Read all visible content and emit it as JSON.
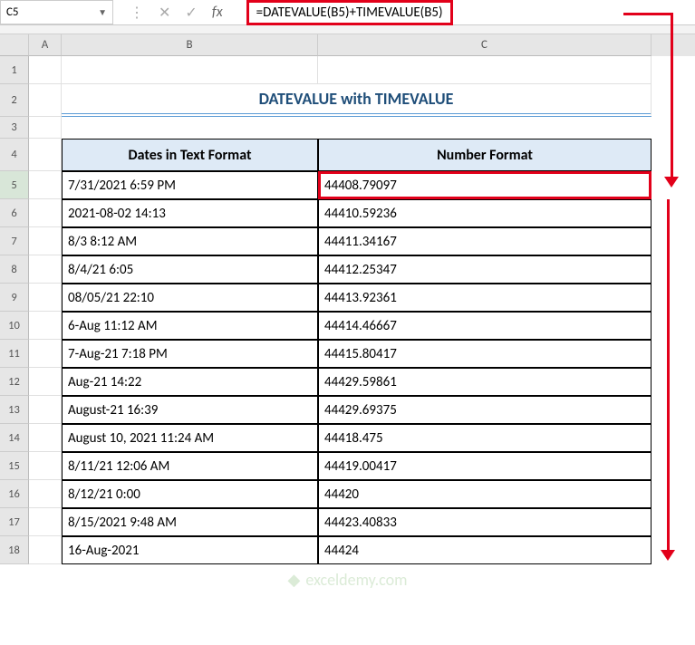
{
  "name_box": "C5",
  "formula": "=DATEVALUE(B5)+TIMEVALUE(B5)",
  "columns": [
    "A",
    "B",
    "C"
  ],
  "title": "DATEVALUE with TIMEVALUE",
  "headers": {
    "B": "Dates in Text Format",
    "C": "Number Format"
  },
  "rows": [
    {
      "n": 5,
      "B": "7/31/2021 6:59 PM",
      "C": "44408.79097"
    },
    {
      "n": 6,
      "B": "2021-08-02 14:13",
      "C": "44410.59236"
    },
    {
      "n": 7,
      "B": "8/3 8:12 AM",
      "C": "44411.34167"
    },
    {
      "n": 8,
      "B": "8/4/21 6:05",
      "C": "44412.25347"
    },
    {
      "n": 9,
      "B": "08/05/21 22:10",
      "C": "44413.92361"
    },
    {
      "n": 10,
      "B": "6-Aug 11:12 AM",
      "C": "44414.46667"
    },
    {
      "n": 11,
      "B": "7-Aug-21 7:18 PM",
      "C": "44415.80417"
    },
    {
      "n": 12,
      "B": "Aug-21 14:22",
      "C": "44429.59861"
    },
    {
      "n": 13,
      "B": "August-21 16:39",
      "C": "44429.69375"
    },
    {
      "n": 14,
      "B": "August 10, 2021 11:24 AM",
      "C": "44418.475"
    },
    {
      "n": 15,
      "B": "8/11/21 12:06 AM",
      "C": "44419.00417"
    },
    {
      "n": 16,
      "B": "8/12/21 0:00",
      "C": "44420"
    },
    {
      "n": 17,
      "B": "8/15/2021 9:48 AM",
      "C": "44423.40833"
    },
    {
      "n": 18,
      "B": "16-Aug-2021",
      "C": "44424"
    }
  ],
  "watermark": "exceldemy.com",
  "chart_data": {
    "type": "table",
    "title": "DATEVALUE with TIMEVALUE",
    "columns": [
      "Dates in Text Format",
      "Number Format"
    ],
    "data": [
      [
        "7/31/2021 6:59 PM",
        44408.79097
      ],
      [
        "2021-08-02 14:13",
        44410.59236
      ],
      [
        "8/3 8:12 AM",
        44411.34167
      ],
      [
        "8/4/21 6:05",
        44412.25347
      ],
      [
        "08/05/21 22:10",
        44413.92361
      ],
      [
        "6-Aug 11:12 AM",
        44414.46667
      ],
      [
        "7-Aug-21 7:18 PM",
        44415.80417
      ],
      [
        "Aug-21 14:22",
        44429.59861
      ],
      [
        "August-21 16:39",
        44429.69375
      ],
      [
        "August 10, 2021 11:24 AM",
        44418.475
      ],
      [
        "8/11/21 12:06 AM",
        44419.00417
      ],
      [
        "8/12/21 0:00",
        44420
      ],
      [
        "8/15/2021 9:48 AM",
        44423.40833
      ],
      [
        "16-Aug-2021",
        44424
      ]
    ]
  }
}
